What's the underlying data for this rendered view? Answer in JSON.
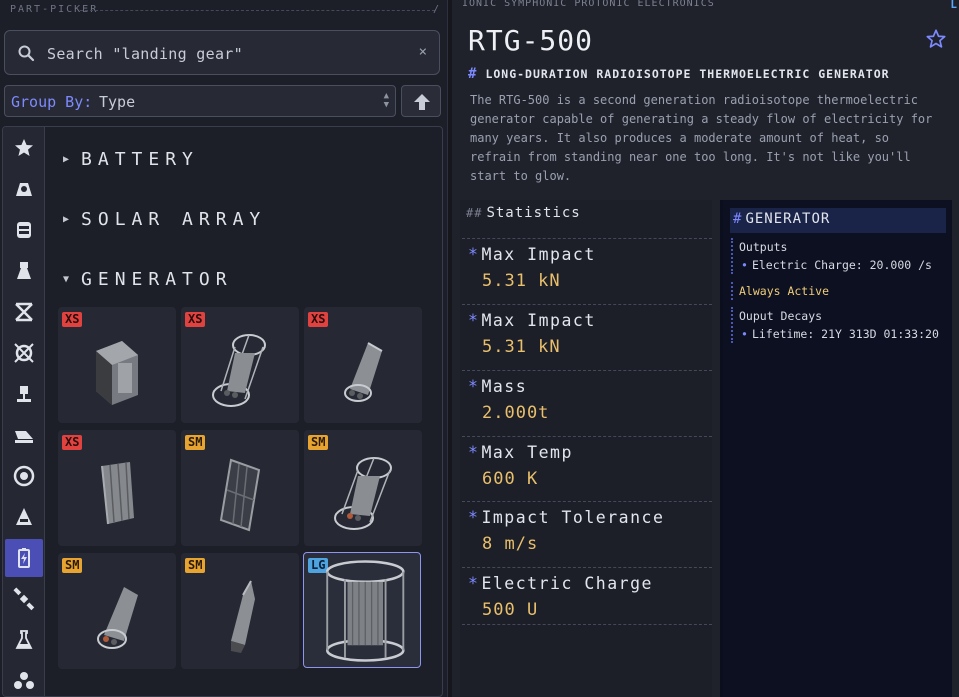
{
  "picker": {
    "title": "PART-PICKER",
    "slash": "/",
    "search_value": "Search \"landing gear\"",
    "clear_symbol": "×",
    "group_by_label": "Group By:",
    "group_by_value": "Type"
  },
  "categories": [
    {
      "icon": "star-icon"
    },
    {
      "icon": "capsule-icon"
    },
    {
      "icon": "fuel-tank-icon"
    },
    {
      "icon": "engine-icon"
    },
    {
      "icon": "structural-icon"
    },
    {
      "icon": "coupling-icon"
    },
    {
      "icon": "landing-leg-icon"
    },
    {
      "icon": "wing-icon"
    },
    {
      "icon": "wheel-icon"
    },
    {
      "icon": "nosecone-icon"
    },
    {
      "icon": "power-icon",
      "active": true
    },
    {
      "icon": "satellite-icon"
    },
    {
      "icon": "science-flask-icon"
    },
    {
      "icon": "cluster-icon"
    }
  ],
  "groups": {
    "battery": "BATTERY",
    "solar": "SOLAR ARRAY",
    "generator": "GENERATOR",
    "collapsed_symbol": "▶",
    "expanded_symbol": "▼"
  },
  "tiles": [
    {
      "size": "XS",
      "kind": "box"
    },
    {
      "size": "XS",
      "kind": "cage"
    },
    {
      "size": "XS",
      "kind": "cone"
    },
    {
      "size": "XS",
      "kind": "fin"
    },
    {
      "size": "SM",
      "kind": "panel"
    },
    {
      "size": "SM",
      "kind": "cage"
    },
    {
      "size": "SM",
      "kind": "cone"
    },
    {
      "size": "SM",
      "kind": "rod"
    },
    {
      "size": "LG",
      "kind": "big-cage",
      "selected": true
    }
  ],
  "detail": {
    "manufacturer": "IONIC SYMPHONIC PROTONIC ELECTRONICS",
    "corner_mark": "L",
    "name": "RTG-500",
    "subtitle_hash": "#",
    "subtitle": "LONG-DURATION RADIOISOTOPE THERMOELECTRIC GENERATOR",
    "description": "The RTG-500 is a second generation radioisotope thermoelectric generator capable of generating a steady flow of electricity for many years. It also produces a moderate amount of heat, so refrain from standing near one too long. It's not like you'll start to glow."
  },
  "stats": {
    "heading_marks": "##",
    "heading": "Statistics",
    "bullet": "*",
    "items": [
      {
        "label": "Max Impact",
        "value": "5.31 kN"
      },
      {
        "label": "Max Impact",
        "value": "5.31 kN"
      },
      {
        "label": "Mass",
        "value": "2.000t"
      },
      {
        "label": "Max Temp",
        "value": "600 K"
      },
      {
        "label": "Impact Tolerance",
        "value": "8 m/s"
      },
      {
        "label": "Electric Charge",
        "value": "500 U"
      }
    ]
  },
  "generator": {
    "hash": "#",
    "heading": "GENERATOR",
    "outputs_title": "Outputs",
    "output_line": "Electric Charge: 20.000 /s",
    "always_active": "Always Active",
    "decay_title": "Ouput Decays",
    "lifetime": "Lifetime: 21Y 313D 01:33:20",
    "dot": "•"
  },
  "colors": {
    "accent": "#7d89ff",
    "value": "#e9bf6c",
    "xs": "#e0433f",
    "sm": "#e8a431",
    "lg": "#4fa3df"
  }
}
